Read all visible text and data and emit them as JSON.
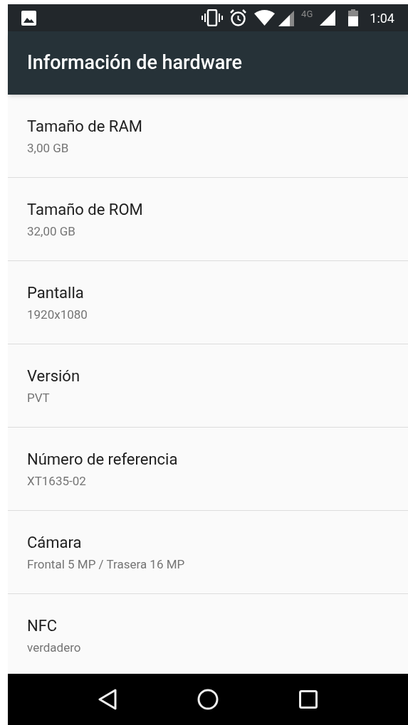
{
  "status_bar": {
    "network_label": "4G",
    "time": "1:04"
  },
  "toolbar": {
    "title": "Información de hardware"
  },
  "items": [
    {
      "title": "Tamaño de RAM",
      "value": "3,00 GB"
    },
    {
      "title": "Tamaño de ROM",
      "value": "32,00 GB"
    },
    {
      "title": "Pantalla",
      "value": "1920x1080"
    },
    {
      "title": "Versión",
      "value": "PVT"
    },
    {
      "title": "Número de referencia",
      "value": "XT1635-02"
    },
    {
      "title": "Cámara",
      "value": "Frontal 5 MP / Trasera 16 MP"
    },
    {
      "title": "NFC",
      "value": "verdadero"
    }
  ]
}
